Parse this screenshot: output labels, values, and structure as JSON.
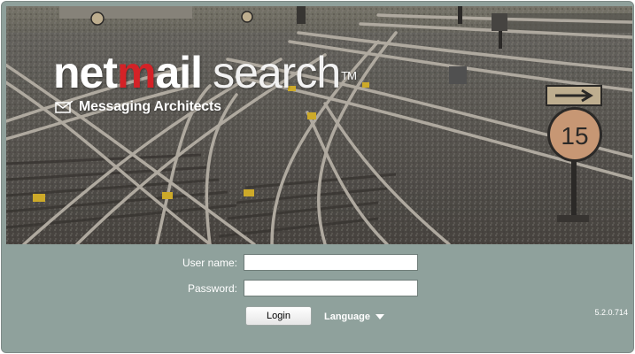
{
  "brand": {
    "logo_part1": "net",
    "logo_part2": "m",
    "logo_part3": "ail",
    "logo_part4": "search",
    "trademark": "TM",
    "subtitle": "Messaging Architects",
    "accent_color": "#d42227",
    "icon": "envelope-icon"
  },
  "hero": {
    "sign_number": "15",
    "sign_arrow": "arrow-right-icon"
  },
  "login": {
    "username_label": "User name:",
    "username_value": "",
    "password_label": "Password:",
    "password_value": "",
    "login_button": "Login",
    "language_label": "Language",
    "language_icon": "triangle-down-icon"
  },
  "footer": {
    "version": "5.2.0.714"
  },
  "colors": {
    "panel_bg": "#8fa19c",
    "label_text": "#ffffff"
  }
}
